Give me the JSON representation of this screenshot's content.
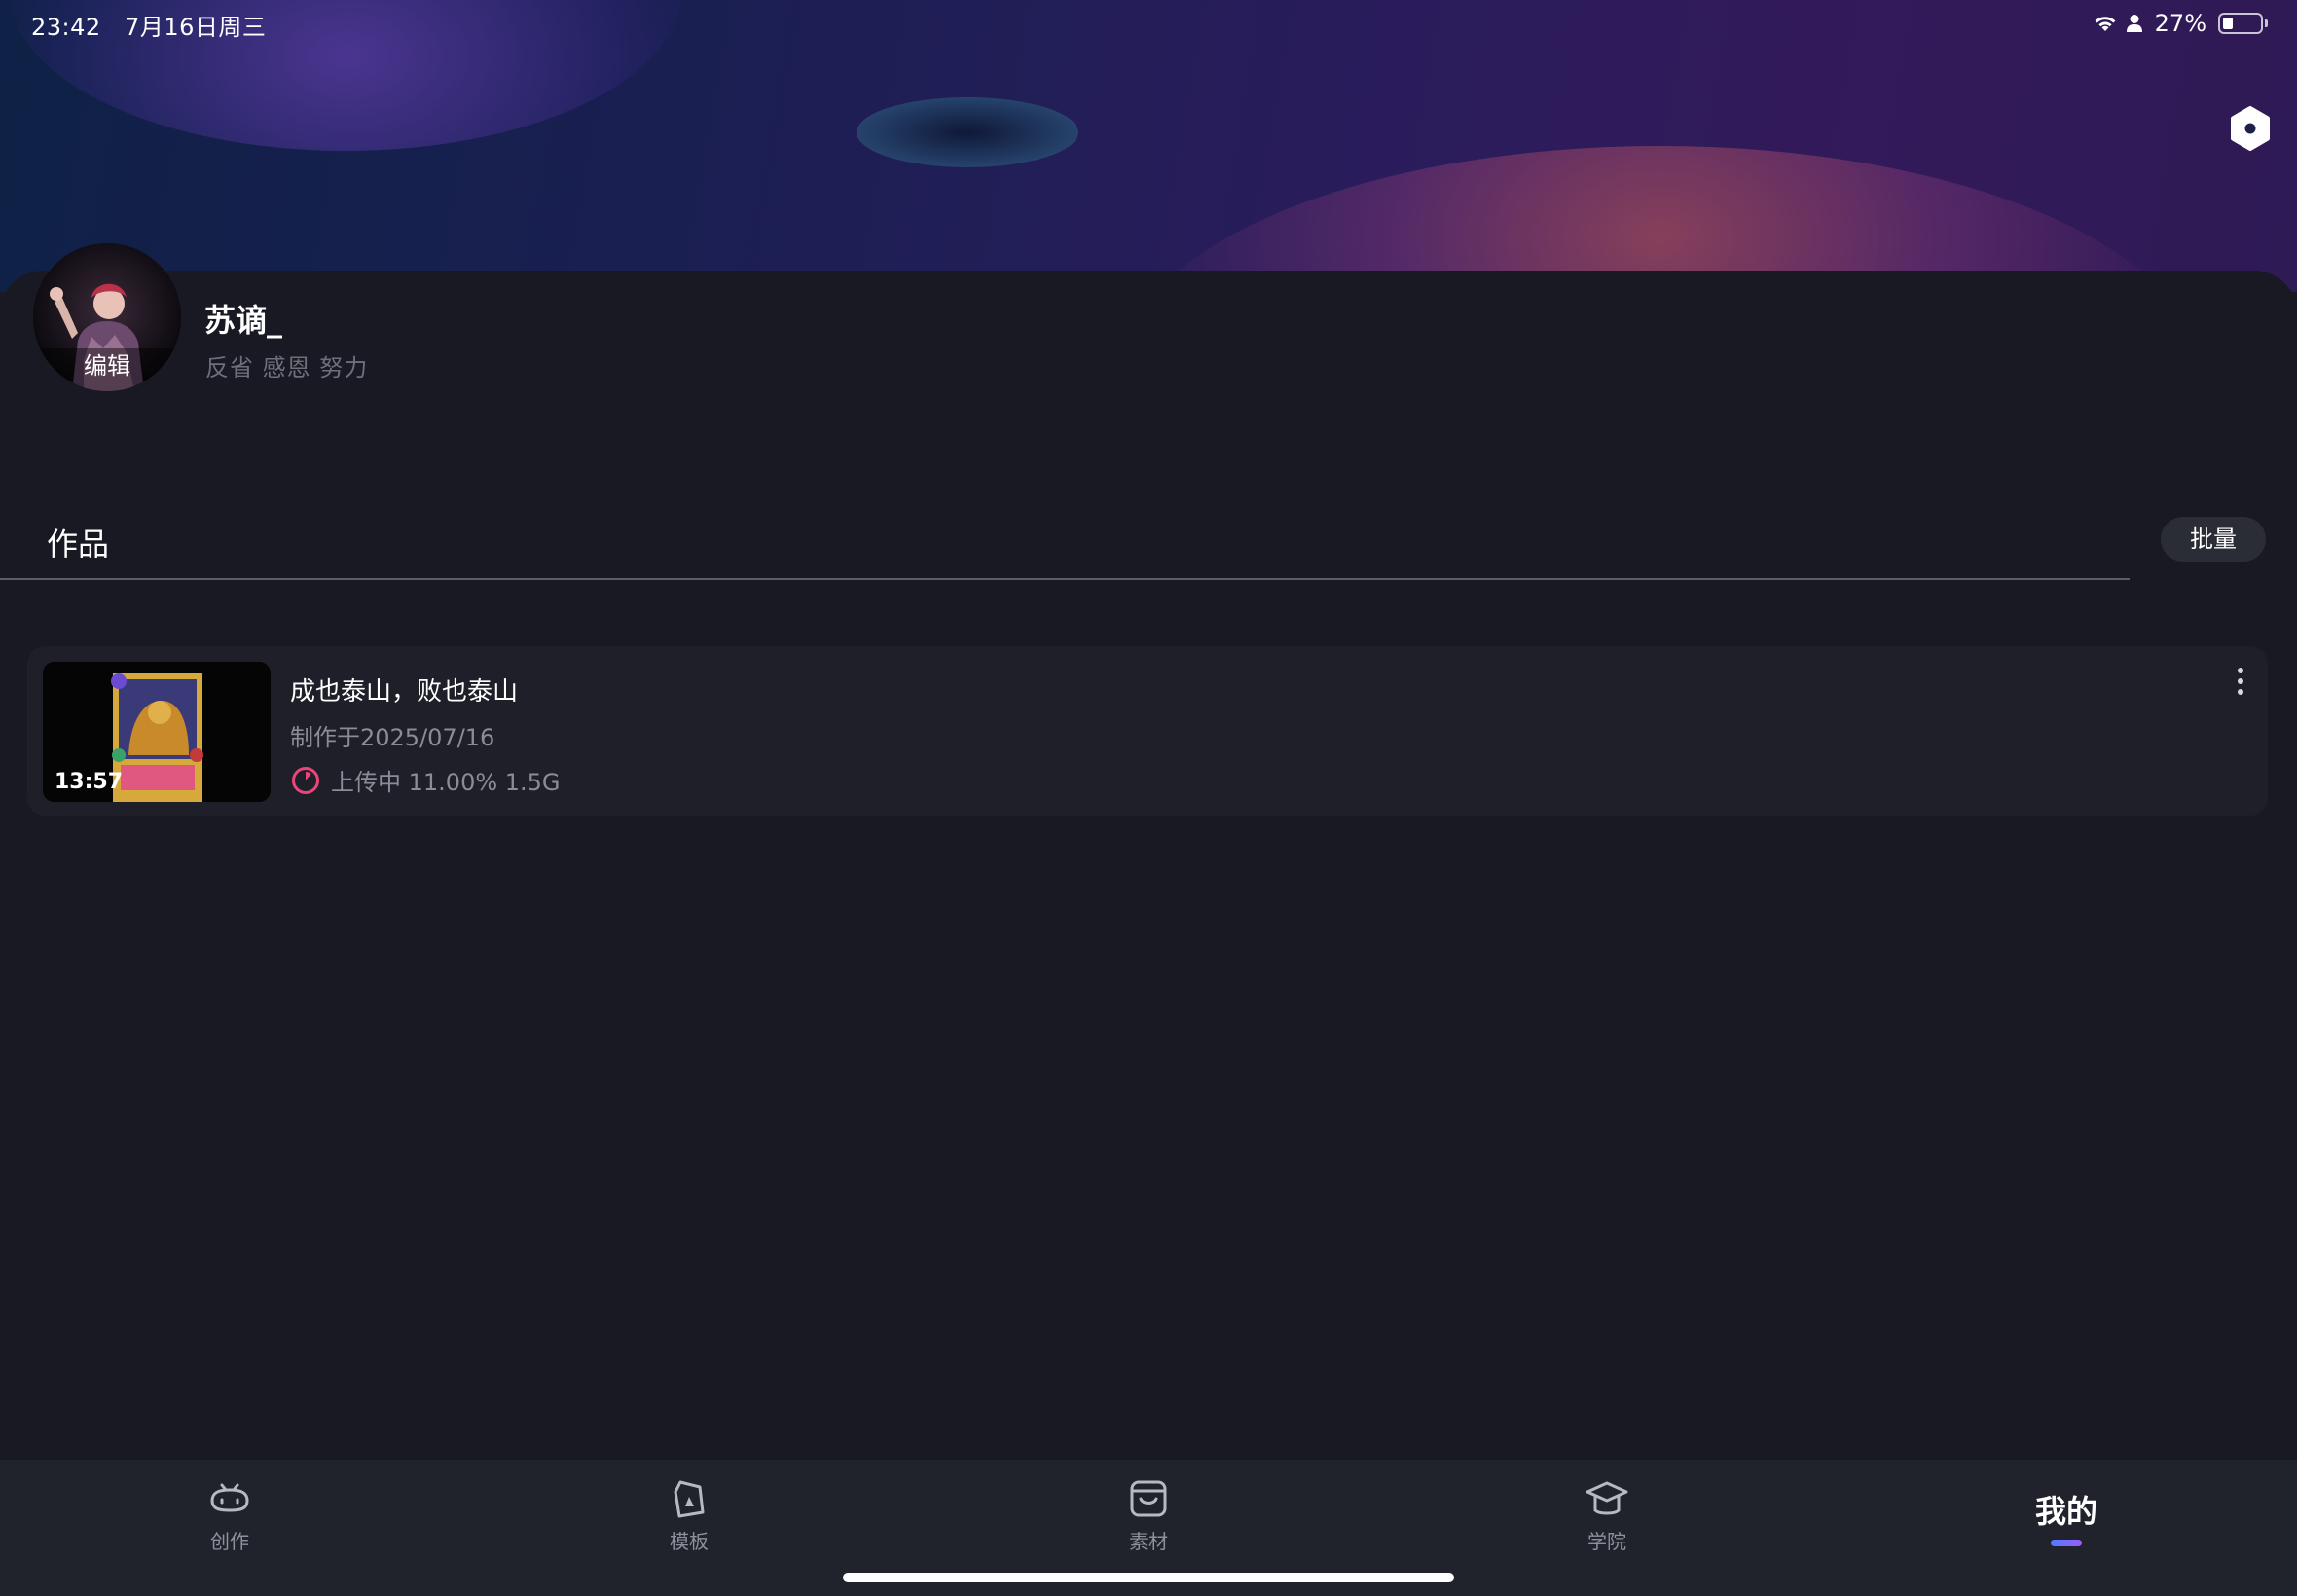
{
  "status_bar": {
    "time": "23:42   7月16日周三",
    "battery_percent": "27%",
    "battery_level": 0.27,
    "icons": [
      "wifi-icon",
      "person-icon",
      "battery-icon"
    ]
  },
  "header": {
    "settings_icon": "hexagon-settings-icon"
  },
  "profile": {
    "username": "苏谪_",
    "bio": "反省 感恩 努力",
    "avatar_edit_label": "编辑"
  },
  "works_section": {
    "tab_label": "作品",
    "batch_label": "批量",
    "items": [
      {
        "title": "成也泰山，败也泰山",
        "date": "制作于2025/07/16",
        "duration": "13:57",
        "upload_status": "上传中 11.00% 1.5G",
        "upload_progress": 0.11
      }
    ]
  },
  "bottom_nav": {
    "items": [
      {
        "label": "创作",
        "icon": "tv-create-icon"
      },
      {
        "label": "模板",
        "icon": "template-card-icon"
      },
      {
        "label": "素材",
        "icon": "store-material-icon"
      },
      {
        "label": "学院",
        "icon": "graduation-cap-icon"
      },
      {
        "label": "我的",
        "icon": ""
      }
    ],
    "active_index": 4
  },
  "colors": {
    "background": "#181922",
    "nav_background": "#20222c",
    "card_background": "#1e1f29",
    "accent_pink": "#e9457a",
    "active_bar_start": "#4f7cff",
    "active_bar_end": "#9a5cf6"
  }
}
